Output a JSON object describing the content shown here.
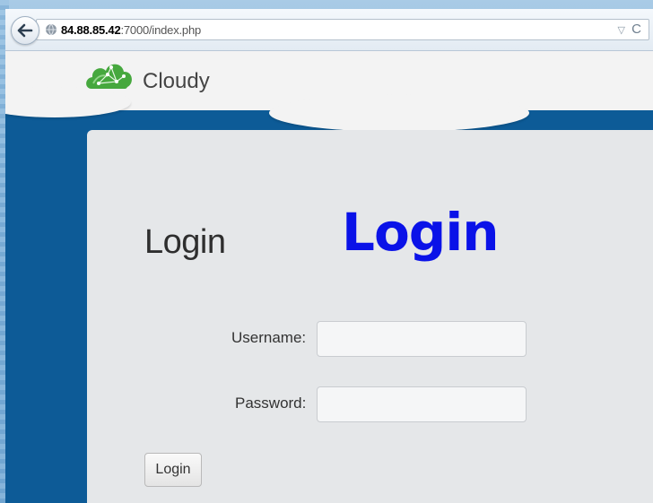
{
  "browser": {
    "url_host": "84.88.85.42",
    "url_rest": ":7000/index.php",
    "dropmarker_glyph": "▽",
    "reload_glyph": "C"
  },
  "header": {
    "brand": "Cloudy",
    "logo_icon": "cloud-network-icon",
    "brand_color": "#3b9b36"
  },
  "login": {
    "heading": "Login",
    "annotation": "Login",
    "username_label": "Username:",
    "password_label": "Password:",
    "username_value": "",
    "password_value": "",
    "submit_label": "Login"
  },
  "colors": {
    "page_bg": "#0d5b97",
    "card_bg": "#e5e7e9",
    "annotation": "#0a12e8"
  }
}
